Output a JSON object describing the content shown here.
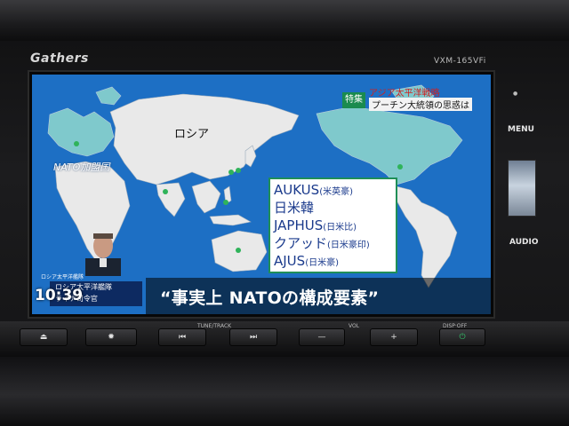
{
  "device": {
    "brand": "Gathers",
    "model": "VXM-165VFi",
    "side_buttons": {
      "menu": "MENU",
      "audio": "AUDIO"
    },
    "bottom_labels": {
      "tune_track": "TUNE/TRACK",
      "vol": "VOL",
      "disp_off": "DISP·OFF"
    },
    "bottom_buttons": {
      "eject": "⏏",
      "settings": "✹",
      "prev": "⏮",
      "next": "⏭",
      "vol_down": "—",
      "vol_up": "+",
      "power": "⏻"
    }
  },
  "broadcast": {
    "headline_tag": "特集",
    "headline_line1": "アジア太平洋戦略",
    "headline_line2": "プーチン大統領の思惑は",
    "map_labels": {
      "russia": "ロシア",
      "nato": "NATO加盟国"
    },
    "alliances": [
      {
        "name": "AUKUS",
        "members": "(米英豪)"
      },
      {
        "name": "日米韓",
        "members": ""
      },
      {
        "name": "JAPHUS",
        "members": "(日米比)"
      },
      {
        "name": "クアッド",
        "members": "(日米豪印)"
      },
      {
        "name": "AJUS",
        "members": "(日米豪)"
      }
    ],
    "caption_small": "ロシア太平洋艦隊",
    "caption_line1": "ロシア太平洋艦隊",
    "caption_line2": "ライナ司令官",
    "clock": "10:39",
    "subtitle": "“事実上 NATOの構成要素”"
  },
  "colors": {
    "ocean": "#1d6fc4",
    "land": "#e9e9e9",
    "nato_land": "#7fc9cc",
    "accent_green": "#1f8f57",
    "alliance_text": "#1a3a8c"
  }
}
